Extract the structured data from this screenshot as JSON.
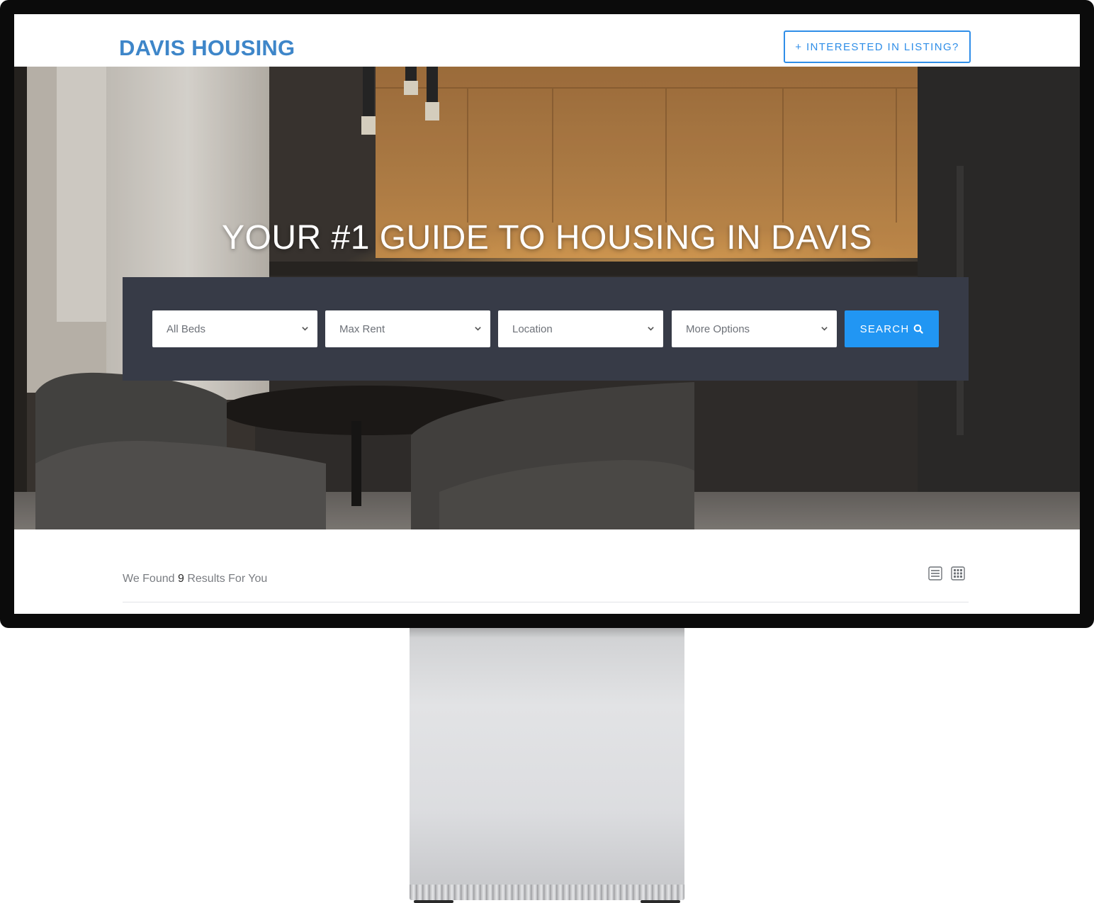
{
  "header": {
    "logo": "DAVIS HOUSING",
    "cta_label": "+ INTERESTED IN LISTING?"
  },
  "hero": {
    "title": "YOUR #1 GUIDE TO HOUSING IN DAVIS"
  },
  "search": {
    "beds": "All Beds",
    "max_rent": "Max Rent",
    "location": "Location",
    "more_options": "More Options",
    "button_label": "SEARCH"
  },
  "results": {
    "prefix": "We Found",
    "count": "9",
    "suffix": "Results For You"
  },
  "colors": {
    "brand": "#3e86c9",
    "accent": "#2196f3",
    "panel": "#373b47"
  },
  "icons": [
    "chevron-down-icon",
    "search-icon",
    "list-view-icon",
    "grid-view-icon"
  ]
}
